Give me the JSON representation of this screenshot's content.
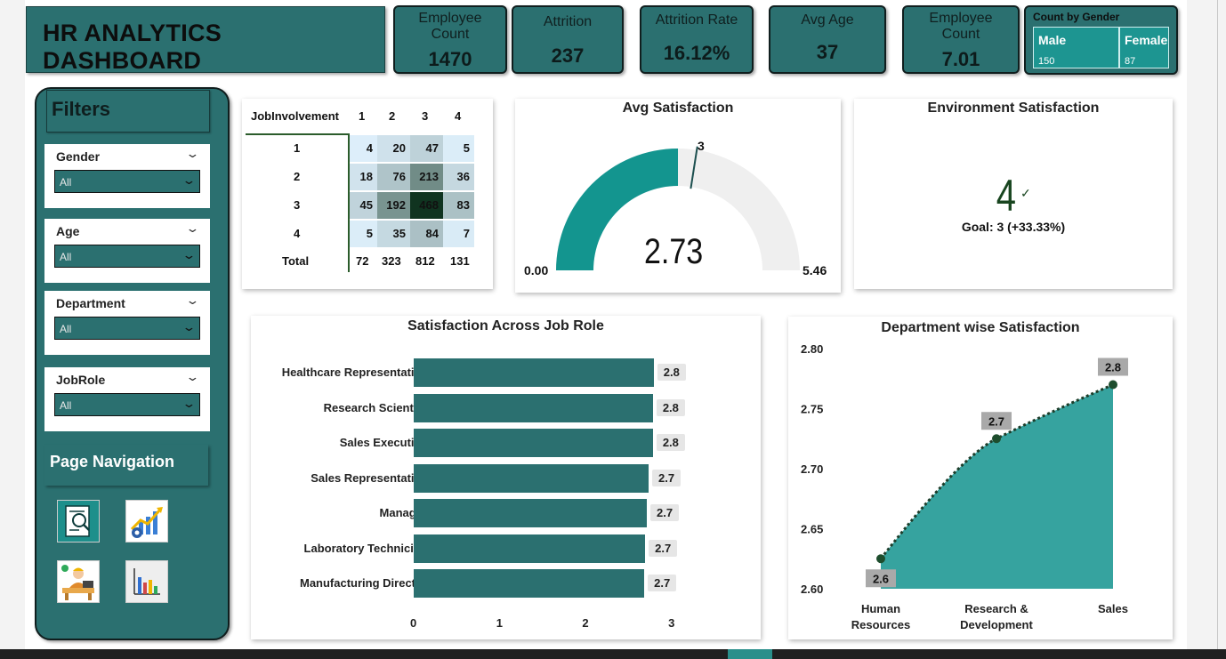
{
  "dashboard": {
    "title": "HR ANALYTICS DASHBOARD"
  },
  "kpis": [
    {
      "label1": "Employee",
      "label2": "Count",
      "value": "1470"
    },
    {
      "label1": "Attrition",
      "label2": "",
      "value": "237"
    },
    {
      "label1": "Attrition Rate",
      "label2": "",
      "value": "16.12%"
    },
    {
      "label1": "Avg Age",
      "label2": "",
      "value": "37"
    },
    {
      "label1": "Employee",
      "label2": "Count",
      "value": "7.01"
    }
  ],
  "gender_card": {
    "title": "Count by Gender",
    "male": {
      "label": "Male",
      "value": "150"
    },
    "female": {
      "label": "Female",
      "value": "87"
    }
  },
  "filters": {
    "title": "Filters",
    "slicers": [
      {
        "label": "Gender",
        "value": "All"
      },
      {
        "label": "Age",
        "value": "All"
      },
      {
        "label": "Department",
        "value": "All"
      },
      {
        "label": "JobRole",
        "value": "All"
      }
    ]
  },
  "navigation": {
    "title": "Page Navigation",
    "icons": [
      "report-search-icon",
      "growth-chart-icon",
      "employee-desk-icon",
      "bar-chart-icon"
    ]
  },
  "matrix": {
    "row_header": "JobInvolvement",
    "columns": [
      "1",
      "2",
      "3",
      "4"
    ],
    "rows": [
      {
        "label": "1",
        "values": [
          4,
          20,
          47,
          5
        ]
      },
      {
        "label": "2",
        "values": [
          18,
          76,
          213,
          36
        ]
      },
      {
        "label": "3",
        "values": [
          45,
          192,
          468,
          83
        ]
      },
      {
        "label": "4",
        "values": [
          5,
          35,
          84,
          7
        ]
      }
    ],
    "total_label": "Total",
    "totals": [
      "72",
      "323",
      "812",
      "131"
    ]
  },
  "gauge": {
    "title": "Avg Satisfaction",
    "value": 2.73,
    "value_text": "2.73",
    "min": 0,
    "min_text": "0.00",
    "max": 5.46,
    "max_text": "5.46",
    "target": 3,
    "target_text": "3",
    "fill_color": "#13958f",
    "track_color": "#efefef"
  },
  "env_card": {
    "title": "Environment Satisfaction",
    "value": "4",
    "goal": "Goal: 3 (+33.33%)"
  },
  "chart_data": [
    {
      "type": "bar",
      "title": "Satisfaction Across Job Role",
      "categories": [
        "Healthcare Representative",
        "Research Scientist",
        "Sales Executive",
        "Sales Representative",
        "Manager",
        "Laboratory Technician",
        "Manufacturing Director"
      ],
      "values": [
        2.79,
        2.78,
        2.78,
        2.73,
        2.71,
        2.69,
        2.68
      ],
      "labels": [
        "2.8",
        "2.8",
        "2.8",
        "2.7",
        "2.7",
        "2.7",
        "2.7"
      ],
      "xticks": [
        "0",
        "1",
        "2",
        "3"
      ],
      "xlim": [
        0,
        3
      ],
      "color": "#2b7070"
    },
    {
      "type": "area",
      "title": "Department wise Satisfaction",
      "categories": [
        "Human Resources",
        "Research & Development",
        "Sales"
      ],
      "category_lines": [
        [
          "Human",
          "Resources"
        ],
        [
          "Research &",
          "Development"
        ],
        [
          "Sales"
        ]
      ],
      "values": [
        2.625,
        2.725,
        2.77
      ],
      "labels": [
        "2.6",
        "2.7",
        "2.8"
      ],
      "yticks": [
        "2.80",
        "2.75",
        "2.70",
        "2.65",
        "2.60"
      ],
      "ylim": [
        2.6,
        2.8
      ],
      "color": "#36a39f"
    }
  ]
}
